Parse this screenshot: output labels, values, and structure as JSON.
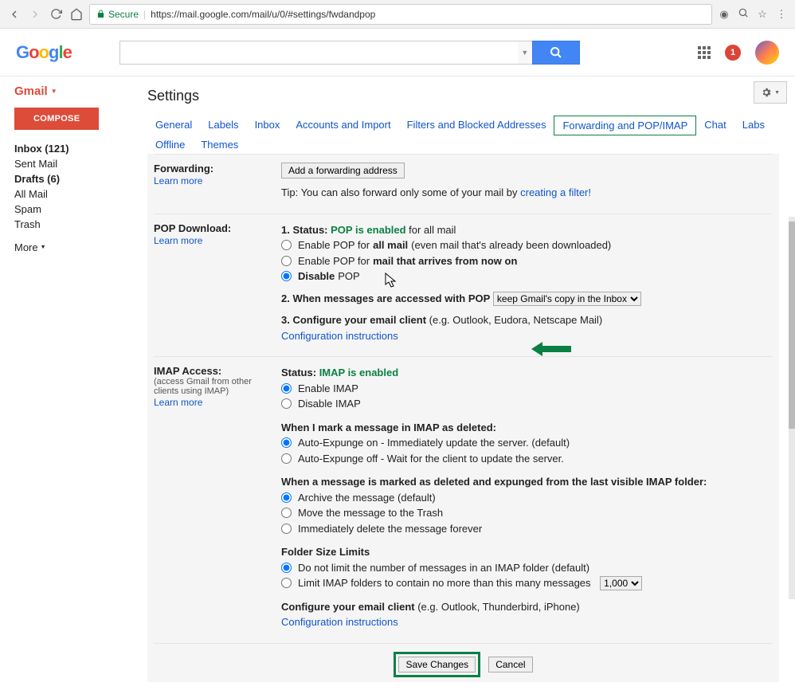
{
  "browser": {
    "secure_label": "Secure",
    "url": "https://mail.google.com/mail/u/0/#settings/fwdandpop"
  },
  "header": {
    "notification_count": "1"
  },
  "sidebar": {
    "gmail_label": "Gmail",
    "compose": "COMPOSE",
    "items": [
      {
        "label": "Inbox (121)",
        "bold": true
      },
      {
        "label": "Sent Mail",
        "bold": false
      },
      {
        "label": "Drafts (6)",
        "bold": true
      },
      {
        "label": "All Mail",
        "bold": false
      },
      {
        "label": "Spam",
        "bold": false
      },
      {
        "label": "Trash",
        "bold": false
      }
    ],
    "more": "More"
  },
  "page_title": "Settings",
  "tabs": [
    "General",
    "Labels",
    "Inbox",
    "Accounts and Import",
    "Filters and Blocked Addresses",
    "Forwarding and POP/IMAP",
    "Chat",
    "Labs",
    "Offline",
    "Themes"
  ],
  "active_tab": "Forwarding and POP/IMAP",
  "forwarding": {
    "title": "Forwarding:",
    "learn_more": "Learn more",
    "add_btn": "Add a forwarding address",
    "tip_prefix": "Tip: You can also forward only some of your mail by ",
    "tip_link": "creating a filter!"
  },
  "pop": {
    "title": "POP Download:",
    "learn_more": "Learn more",
    "status_label": "1. Status:",
    "status_value": "POP is enabled",
    "status_suffix": " for all mail",
    "opt1_pre": "Enable POP for ",
    "opt1_bold": "all mail",
    "opt1_post": " (even mail that's already been downloaded)",
    "opt2_pre": "Enable POP for ",
    "opt2_bold": "mail that arrives from now on",
    "opt3_bold": "Disable",
    "opt3_post": " POP",
    "line2": "2. When messages are accessed with POP",
    "select_value": "keep Gmail's copy in the Inbox",
    "line3_pre": "3. Configure your email client",
    "line3_post": " (e.g. Outlook, Eudora, Netscape Mail)",
    "config_link": "Configuration instructions"
  },
  "imap": {
    "title": "IMAP Access:",
    "sub": "(access Gmail from other clients using IMAP)",
    "learn_more": "Learn more",
    "status_label": "Status:",
    "status_value": "IMAP is enabled",
    "opt_enable": "Enable IMAP",
    "opt_disable": "Disable IMAP",
    "deleted_heading": "When I mark a message in IMAP as deleted:",
    "del_opt1": "Auto-Expunge on - Immediately update the server. (default)",
    "del_opt2": "Auto-Expunge off - Wait for the client to update the server.",
    "expunge_heading": "When a message is marked as deleted and expunged from the last visible IMAP folder:",
    "exp_opt1": "Archive the message (default)",
    "exp_opt2": "Move the message to the Trash",
    "exp_opt3": "Immediately delete the message forever",
    "folder_heading": "Folder Size Limits",
    "fld_opt1": "Do not limit the number of messages in an IMAP folder (default)",
    "fld_opt2": "Limit IMAP folders to contain no more than this many messages",
    "fld_select": "1,000",
    "configure_pre": "Configure your email client",
    "configure_post": " (e.g. Outlook, Thunderbird, iPhone)",
    "config_link": "Configuration instructions"
  },
  "buttons": {
    "save": "Save Changes",
    "cancel": "Cancel"
  }
}
